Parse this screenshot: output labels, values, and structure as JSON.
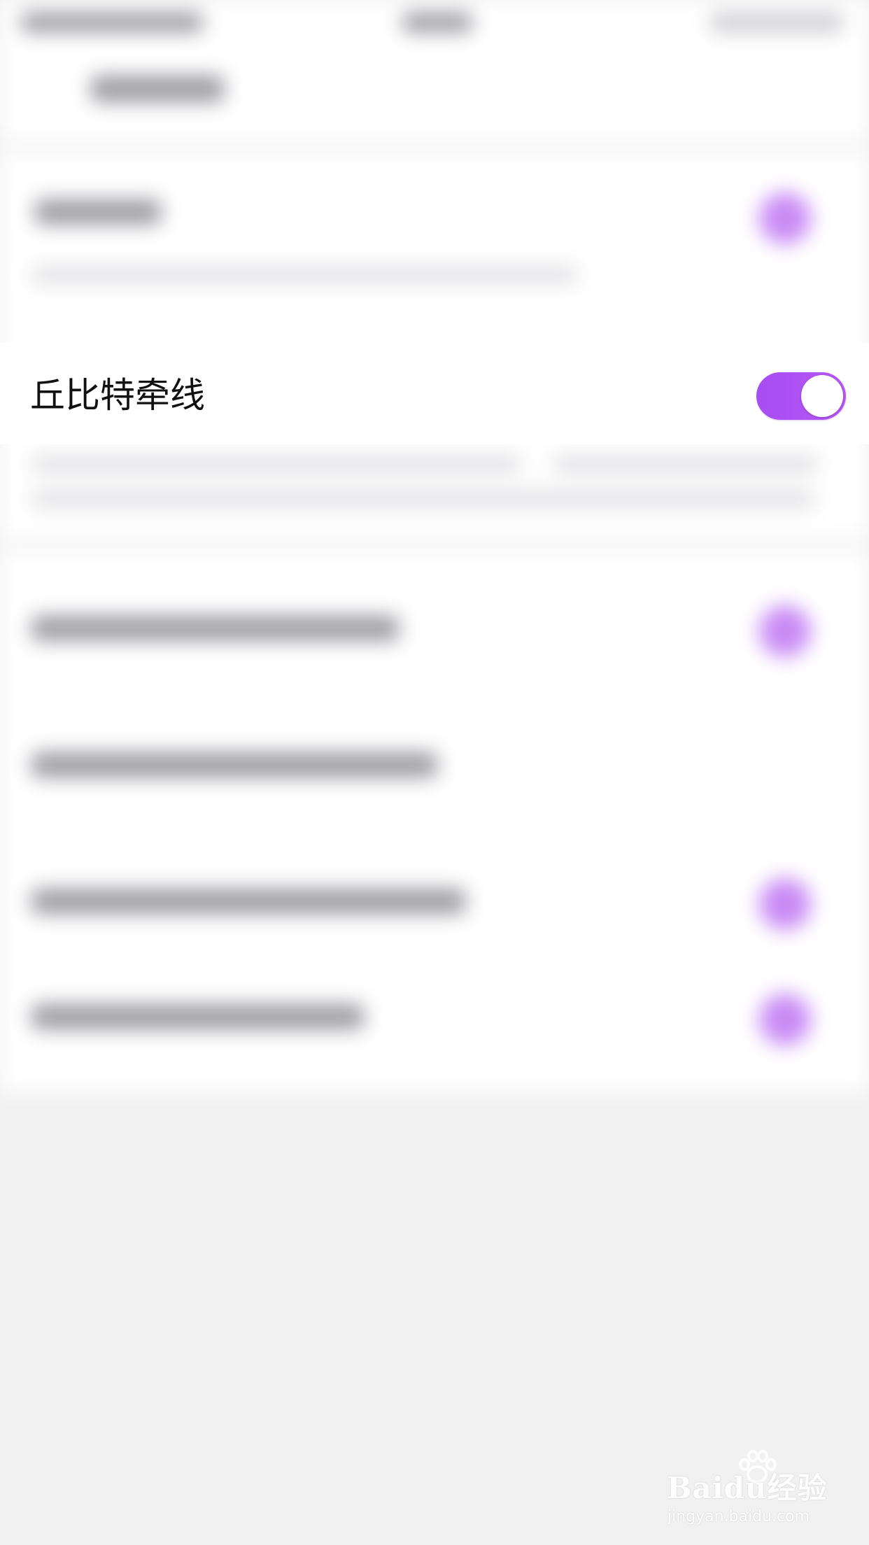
{
  "focused_setting": {
    "label": "丘比特牵线",
    "toggle_on": true
  },
  "colors": {
    "accent": "#a64df2",
    "background": "#f1f1f2",
    "row_background": "#ffffff",
    "label_text": "#111111"
  },
  "watermark": {
    "brand": "Baidu经验",
    "url": "jingyan.baidu.com"
  }
}
